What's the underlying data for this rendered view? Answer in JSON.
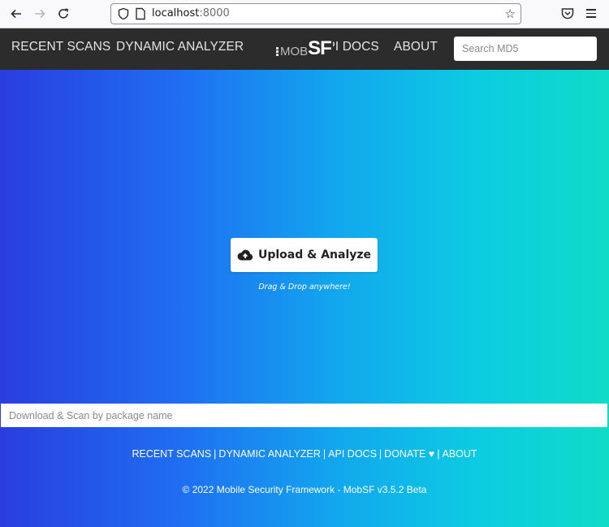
{
  "browser": {
    "url_host": "localhost",
    "url_port": ":8000",
    "icons": [
      "back-arrow-icon",
      "forward-arrow-icon",
      "reload-icon",
      "shield-icon",
      "page-icon",
      "star-icon",
      "pocket-icon",
      "hamburger-menu-icon"
    ]
  },
  "navbar": {
    "links": [
      "RECENT SCANS",
      "DYNAMIC ANALYZER",
      "API DOCS",
      "ABOUT"
    ],
    "brand_mob": "MOB",
    "brand_sf": "SF",
    "search_placeholder": "Search MD5"
  },
  "main": {
    "upload_label": "Upload & Analyze",
    "drag_hint": "Drag & Drop anywhere!",
    "package_placeholder": "Download & Scan by package name",
    "gradient_colors": [
      "#2a3de0",
      "#1f6ff2",
      "#12a6ee",
      "#0ccbe2",
      "#0fdcc8"
    ]
  },
  "footer": {
    "links": [
      "RECENT SCANS",
      "DYNAMIC ANALYZER",
      "API DOCS",
      "DONATE ♥",
      "ABOUT"
    ],
    "copyright": "© 2022 Mobile Security Framework - MobSF v3.5.2 Beta"
  }
}
